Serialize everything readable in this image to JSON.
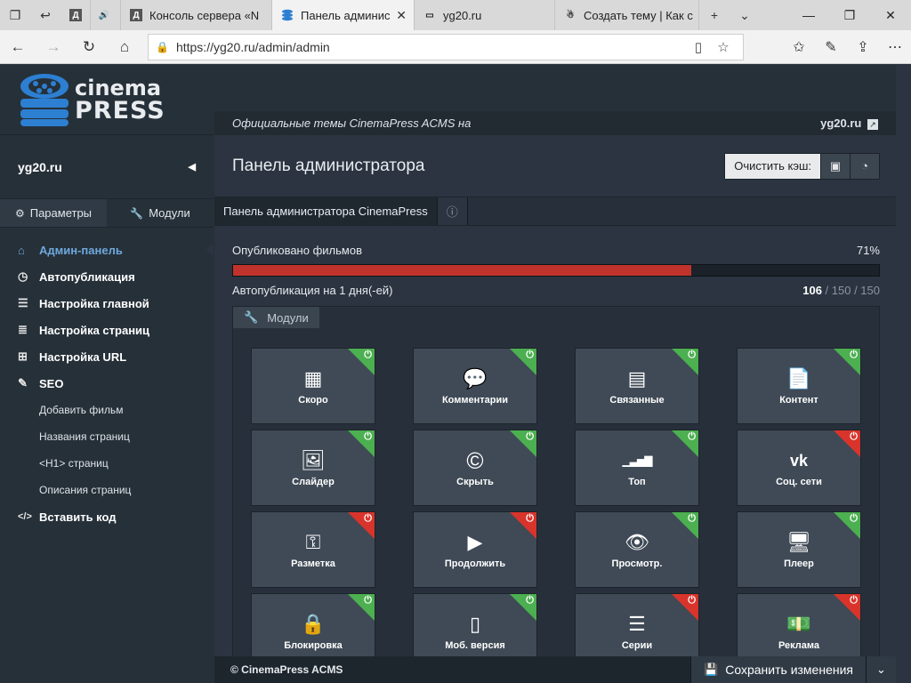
{
  "browser": {
    "tabs": [
      {
        "title": "",
        "icon": "document-icon"
      },
      {
        "title": "",
        "icon": "speaker-icon"
      },
      {
        "title": "Консоль сервера «N",
        "icon": "d-icon"
      },
      {
        "title": "Панель админис",
        "icon": "stack-icon",
        "active": true
      },
      {
        "title": "yg20.ru",
        "icon": "page-icon"
      },
      {
        "title": "Создать тему | Как с",
        "icon": "forum-icon"
      }
    ],
    "url": "https://yg20.ru/admin/admin"
  },
  "logo": {
    "line1": "cinema",
    "line2": "PRESS"
  },
  "sidebar": {
    "site_name": "yg20.ru",
    "tabs": [
      {
        "label": "Параметры",
        "icon": "gear-icon"
      },
      {
        "label": "Модули",
        "icon": "wrench-icon"
      }
    ],
    "menu": [
      {
        "label": "Админ-панель",
        "icon": "home-icon",
        "current": true
      },
      {
        "label": "Автопубликация",
        "icon": "clock-icon"
      },
      {
        "label": "Настройка главной",
        "icon": "bars-icon"
      },
      {
        "label": "Настройка страниц",
        "icon": "list-icon"
      },
      {
        "label": "Настройка URL",
        "icon": "sitemap-icon"
      },
      {
        "label": "SEO",
        "icon": "pencil-icon"
      }
    ],
    "submenu": [
      "Добавить фильм",
      "Названия страниц",
      "<H1> страниц",
      "Описания страниц"
    ],
    "extra": {
      "label": "Вставить код",
      "icon": "code-icon"
    }
  },
  "main": {
    "announce_text": "Официальные темы CinemaPress ACMS на",
    "announce_link": "yg20.ru",
    "title": "Панель администратора",
    "cache_label": "Очистить кэш:",
    "tab_label": "Панель администратора CinemaPress",
    "published_label": "Опубликовано фильмов",
    "published_percent": "71%",
    "published_fraction": 0.71,
    "auto_label": "Автопубликация на 1 дня(-ей)",
    "auto_done": "106",
    "auto_rest": " / 150 / 150",
    "modules_label": "Модули"
  },
  "modules": [
    {
      "label": "Скоро",
      "icon": "calendar-icon",
      "on": true
    },
    {
      "label": "Комментарии",
      "icon": "comments-icon",
      "on": true
    },
    {
      "label": "Связанные",
      "icon": "list-window-icon",
      "on": true
    },
    {
      "label": "Контент",
      "icon": "file-icon",
      "on": true
    },
    {
      "label": "Слайдер",
      "icon": "image-icon",
      "on": true
    },
    {
      "label": "Скрыть",
      "icon": "copyright-icon",
      "on": true
    },
    {
      "label": "Топ",
      "icon": "signal-icon",
      "on": true
    },
    {
      "label": "Соц. сети",
      "icon": "vk-icon",
      "on": false
    },
    {
      "label": "Разметка",
      "icon": "key-icon",
      "on": false
    },
    {
      "label": "Продолжить",
      "icon": "play-icon",
      "on": false
    },
    {
      "label": "Просмотр.",
      "icon": "eye-icon",
      "on": true
    },
    {
      "label": "Плеер",
      "icon": "monitor-icon",
      "on": true
    },
    {
      "label": "Блокировка",
      "icon": "lock-icon",
      "on": true
    },
    {
      "label": "Моб. версия",
      "icon": "mobile-icon",
      "on": true
    },
    {
      "label": "Серии",
      "icon": "list-icon",
      "on": false
    },
    {
      "label": "Реклама",
      "icon": "money-icon",
      "on": false
    }
  ],
  "footer": {
    "copyright": "© CinemaPress ACMS",
    "save_label": "Сохранить изменения"
  },
  "colors": {
    "on": "#4caf50",
    "off": "#d9342b",
    "progress": "#c0332c",
    "accent": "#6ea8dd"
  }
}
